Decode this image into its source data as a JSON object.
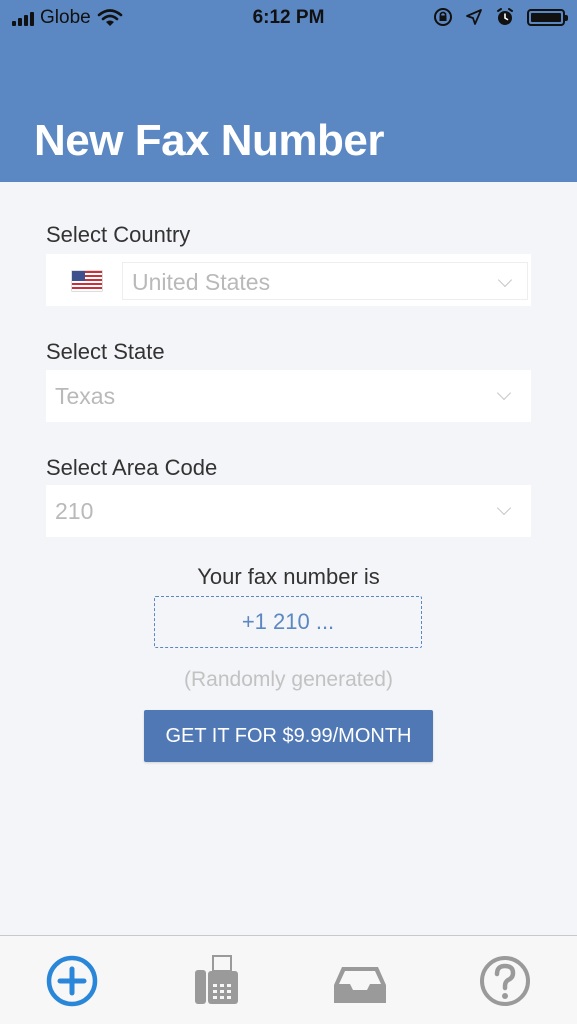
{
  "status_bar": {
    "carrier": "Globe",
    "time": "6:12 PM"
  },
  "header": {
    "title": "New Fax Number"
  },
  "form": {
    "country": {
      "label": "Select Country",
      "value": "United States",
      "flag": "us-flag-icon"
    },
    "state": {
      "label": "Select State",
      "value": "Texas"
    },
    "area_code": {
      "label": "Select Area Code",
      "value": "210"
    }
  },
  "result": {
    "caption": "Your fax number is",
    "number": "+1 210 ...",
    "note": "(Randomly generated)"
  },
  "cta": {
    "label": "GET IT FOR $9.99/MONTH"
  },
  "tabbar": {
    "items": [
      {
        "icon": "plus-circle-icon",
        "active": true
      },
      {
        "icon": "fax-machine-icon",
        "active": false
      },
      {
        "icon": "inbox-tray-icon",
        "active": false
      },
      {
        "icon": "help-circle-icon",
        "active": false
      }
    ]
  },
  "colors": {
    "brand": "#5b87c2",
    "button": "#4f78b5",
    "active_tab": "#2a86d8",
    "inactive_tab": "#9a9a9a"
  }
}
